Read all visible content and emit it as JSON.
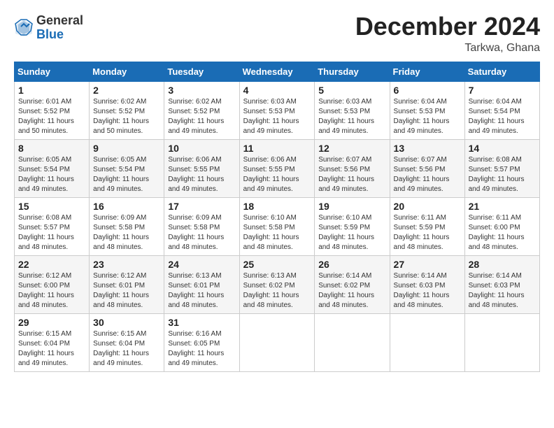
{
  "logo": {
    "general": "General",
    "blue": "Blue"
  },
  "title": "December 2024",
  "location": "Tarkwa, Ghana",
  "days_of_week": [
    "Sunday",
    "Monday",
    "Tuesday",
    "Wednesday",
    "Thursday",
    "Friday",
    "Saturday"
  ],
  "weeks": [
    [
      {
        "day": "1",
        "sunrise": "6:01 AM",
        "sunset": "5:52 PM",
        "daylight": "11 hours and 50 minutes."
      },
      {
        "day": "2",
        "sunrise": "6:02 AM",
        "sunset": "5:52 PM",
        "daylight": "11 hours and 50 minutes."
      },
      {
        "day": "3",
        "sunrise": "6:02 AM",
        "sunset": "5:52 PM",
        "daylight": "11 hours and 49 minutes."
      },
      {
        "day": "4",
        "sunrise": "6:03 AM",
        "sunset": "5:53 PM",
        "daylight": "11 hours and 49 minutes."
      },
      {
        "day": "5",
        "sunrise": "6:03 AM",
        "sunset": "5:53 PM",
        "daylight": "11 hours and 49 minutes."
      },
      {
        "day": "6",
        "sunrise": "6:04 AM",
        "sunset": "5:53 PM",
        "daylight": "11 hours and 49 minutes."
      },
      {
        "day": "7",
        "sunrise": "6:04 AM",
        "sunset": "5:54 PM",
        "daylight": "11 hours and 49 minutes."
      }
    ],
    [
      {
        "day": "8",
        "sunrise": "6:05 AM",
        "sunset": "5:54 PM",
        "daylight": "11 hours and 49 minutes."
      },
      {
        "day": "9",
        "sunrise": "6:05 AM",
        "sunset": "5:54 PM",
        "daylight": "11 hours and 49 minutes."
      },
      {
        "day": "10",
        "sunrise": "6:06 AM",
        "sunset": "5:55 PM",
        "daylight": "11 hours and 49 minutes."
      },
      {
        "day": "11",
        "sunrise": "6:06 AM",
        "sunset": "5:55 PM",
        "daylight": "11 hours and 49 minutes."
      },
      {
        "day": "12",
        "sunrise": "6:07 AM",
        "sunset": "5:56 PM",
        "daylight": "11 hours and 49 minutes."
      },
      {
        "day": "13",
        "sunrise": "6:07 AM",
        "sunset": "5:56 PM",
        "daylight": "11 hours and 49 minutes."
      },
      {
        "day": "14",
        "sunrise": "6:08 AM",
        "sunset": "5:57 PM",
        "daylight": "11 hours and 49 minutes."
      }
    ],
    [
      {
        "day": "15",
        "sunrise": "6:08 AM",
        "sunset": "5:57 PM",
        "daylight": "11 hours and 48 minutes."
      },
      {
        "day": "16",
        "sunrise": "6:09 AM",
        "sunset": "5:58 PM",
        "daylight": "11 hours and 48 minutes."
      },
      {
        "day": "17",
        "sunrise": "6:09 AM",
        "sunset": "5:58 PM",
        "daylight": "11 hours and 48 minutes."
      },
      {
        "day": "18",
        "sunrise": "6:10 AM",
        "sunset": "5:58 PM",
        "daylight": "11 hours and 48 minutes."
      },
      {
        "day": "19",
        "sunrise": "6:10 AM",
        "sunset": "5:59 PM",
        "daylight": "11 hours and 48 minutes."
      },
      {
        "day": "20",
        "sunrise": "6:11 AM",
        "sunset": "5:59 PM",
        "daylight": "11 hours and 48 minutes."
      },
      {
        "day": "21",
        "sunrise": "6:11 AM",
        "sunset": "6:00 PM",
        "daylight": "11 hours and 48 minutes."
      }
    ],
    [
      {
        "day": "22",
        "sunrise": "6:12 AM",
        "sunset": "6:00 PM",
        "daylight": "11 hours and 48 minutes."
      },
      {
        "day": "23",
        "sunrise": "6:12 AM",
        "sunset": "6:01 PM",
        "daylight": "11 hours and 48 minutes."
      },
      {
        "day": "24",
        "sunrise": "6:13 AM",
        "sunset": "6:01 PM",
        "daylight": "11 hours and 48 minutes."
      },
      {
        "day": "25",
        "sunrise": "6:13 AM",
        "sunset": "6:02 PM",
        "daylight": "11 hours and 48 minutes."
      },
      {
        "day": "26",
        "sunrise": "6:14 AM",
        "sunset": "6:02 PM",
        "daylight": "11 hours and 48 minutes."
      },
      {
        "day": "27",
        "sunrise": "6:14 AM",
        "sunset": "6:03 PM",
        "daylight": "11 hours and 48 minutes."
      },
      {
        "day": "28",
        "sunrise": "6:14 AM",
        "sunset": "6:03 PM",
        "daylight": "11 hours and 48 minutes."
      }
    ],
    [
      {
        "day": "29",
        "sunrise": "6:15 AM",
        "sunset": "6:04 PM",
        "daylight": "11 hours and 49 minutes."
      },
      {
        "day": "30",
        "sunrise": "6:15 AM",
        "sunset": "6:04 PM",
        "daylight": "11 hours and 49 minutes."
      },
      {
        "day": "31",
        "sunrise": "6:16 AM",
        "sunset": "6:05 PM",
        "daylight": "11 hours and 49 minutes."
      },
      null,
      null,
      null,
      null
    ]
  ]
}
